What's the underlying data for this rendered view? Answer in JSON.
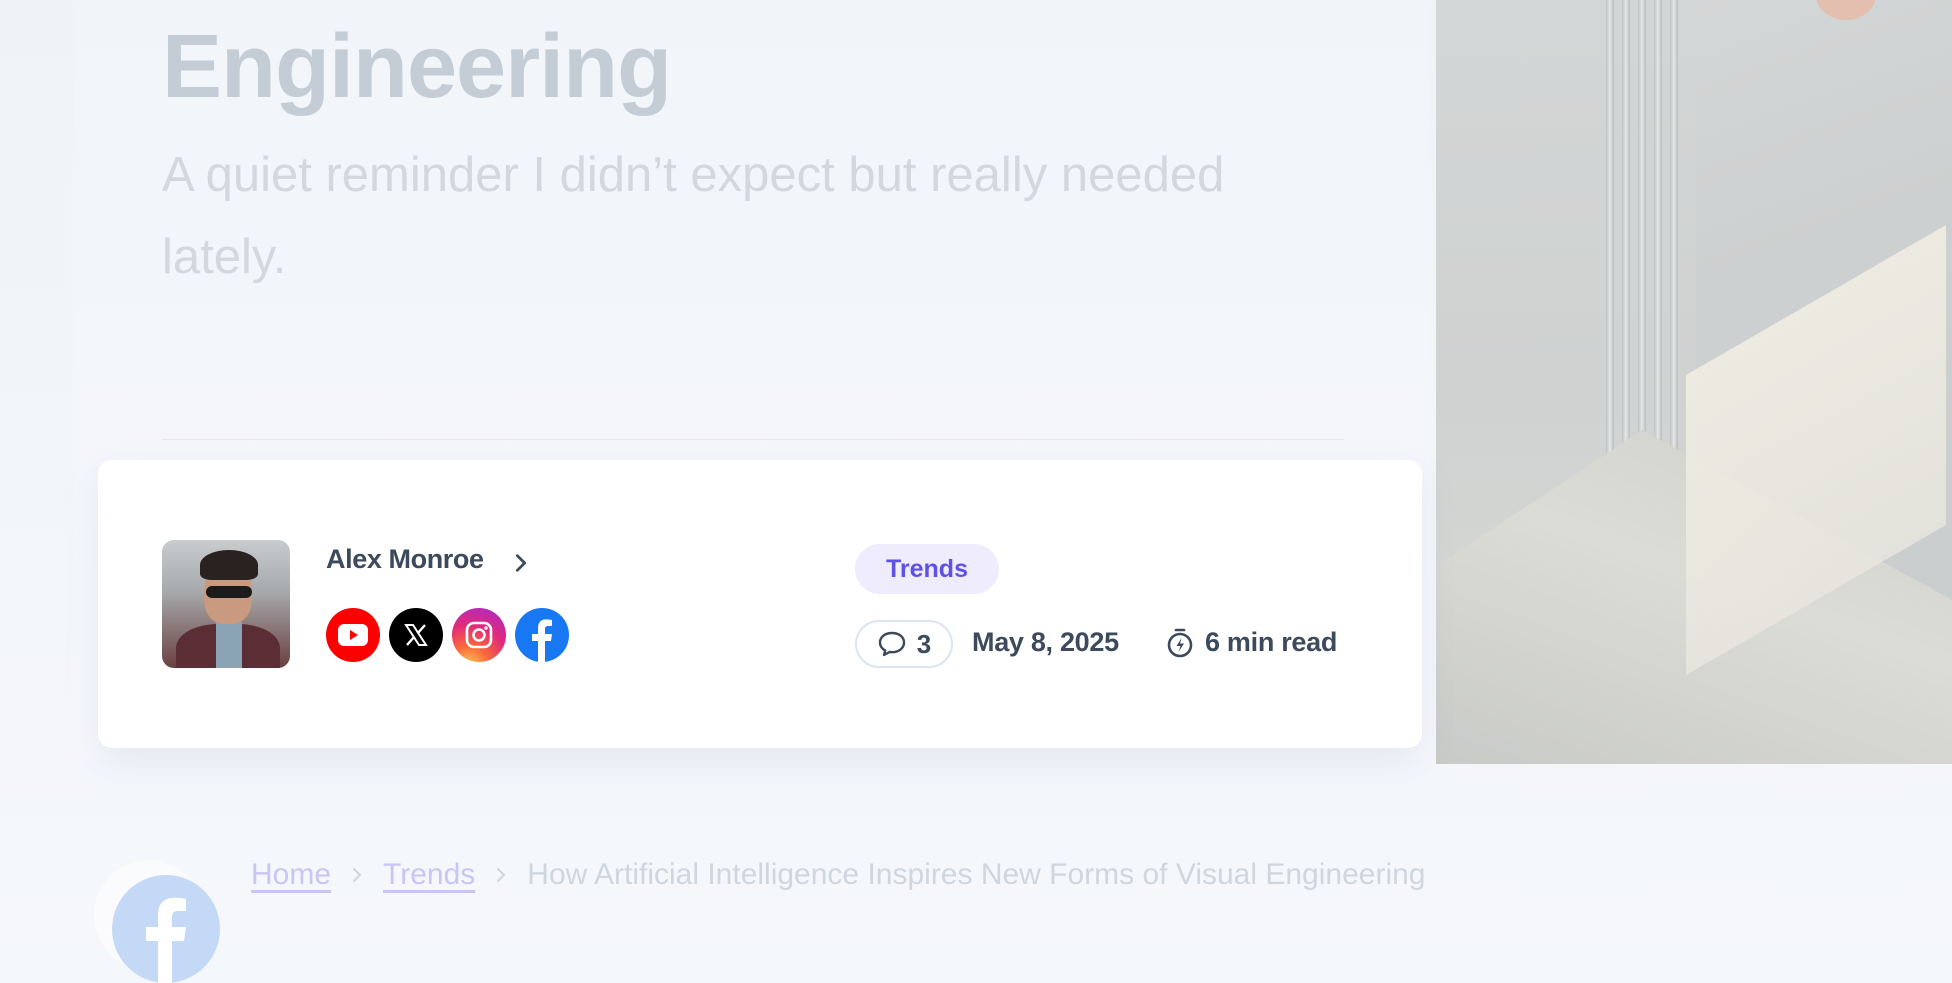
{
  "article": {
    "title_fragment": "Engineering",
    "subtitle": "A quiet reminder I didn’t expect but really needed lately."
  },
  "author": {
    "name": "Alex Monroe",
    "social": [
      {
        "icon": "youtube-icon",
        "color": "#ff0000"
      },
      {
        "icon": "x-icon",
        "color": "#000000"
      },
      {
        "icon": "instagram-icon",
        "color": "#e12a7a"
      },
      {
        "icon": "facebook-icon",
        "color": "#1877f2"
      }
    ]
  },
  "meta": {
    "category": "Trends",
    "comments": "3",
    "date": "May 8, 2025",
    "read_time": "6 min read"
  },
  "breadcrumb": {
    "home": "Home",
    "category": "Trends",
    "current": "How Artificial Intelligence Inspires New Forms of Visual Engineering"
  },
  "colors": {
    "accent": "#6051e6",
    "tag_bg": "#eeecfd",
    "text_dark": "#3c4a5c"
  }
}
